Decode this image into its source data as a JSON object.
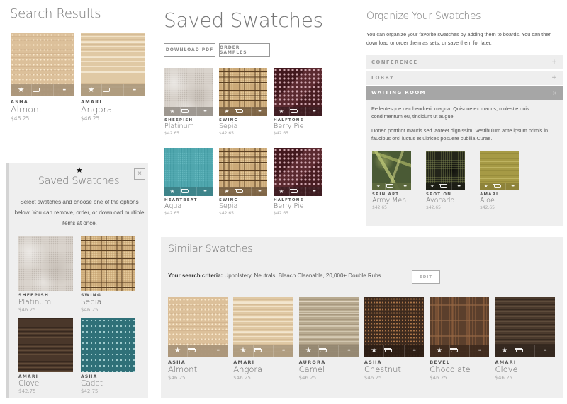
{
  "search_results": {
    "title": "Search Results",
    "items": [
      {
        "brand": "ASHA",
        "name": "Almont",
        "price": "$46.25",
        "texture": "almont",
        "bar_color": "#a99479"
      },
      {
        "brand": "AMARI",
        "name": "Angora",
        "price": "$46.25",
        "texture": "angora",
        "bar_color": "#ad9a7e"
      }
    ]
  },
  "saved_swatches": {
    "title": "Saved Swatches",
    "buttons": {
      "download": "DOWNLOAD PDF",
      "order": "ORDER SAMPLES"
    },
    "items": [
      {
        "brand": "SHEEPISH",
        "name": "Platinum",
        "price": "$42.65",
        "texture": "platinum",
        "bar_color": "#9a948d"
      },
      {
        "brand": "SWING",
        "name": "Sepia",
        "price": "$42.65",
        "texture": "sepia",
        "bar_color": "#7d6446"
      },
      {
        "brand": "HALFTONE",
        "name": "Berry Pie",
        "price": "$42.65",
        "texture": "berry",
        "bar_color": "#3e1d22"
      },
      {
        "brand": "HEARTBEAT",
        "name": "Aqua",
        "price": "$42.65",
        "texture": "aqua",
        "bar_color": "#3c8187"
      },
      {
        "brand": "SWING",
        "name": "Sepia",
        "price": "$42.65",
        "texture": "sepia",
        "bar_color": "#7d6446"
      },
      {
        "brand": "HALFTONE",
        "name": "Berry Pie",
        "price": "$42.65",
        "texture": "berry",
        "bar_color": "#3e1d22"
      }
    ]
  },
  "organize": {
    "title": "Organize Your Swatches",
    "intro": "You can organize your favorite swatches by adding them to boards. You can then download or order them as sets, or save them for later.",
    "boards": [
      {
        "label": "CONFERENCE",
        "icon": "+",
        "expanded": false
      },
      {
        "label": "LOBBY",
        "icon": "+",
        "expanded": false
      },
      {
        "label": "WAITING ROOM",
        "icon": "×",
        "expanded": true
      }
    ],
    "panel": {
      "para1": "Pellentesque nec hendrerit magna. Quisque ex mauris, molestie quis condimentum eu, tincidunt ut augue.",
      "para2": "Donec porttitor mauris sed laoreet dignissim. Vestibulum ante ipsum primis in faucibus orci luctus et ultrices posuere cubilia Curae.",
      "items": [
        {
          "brand": "SPIN ART",
          "name": "Army Men",
          "price": "$42.65",
          "texture": "army",
          "bar_color": "#5d6a3d"
        },
        {
          "brand": "SPOT ON",
          "name": "Avocado",
          "price": "$42.65",
          "texture": "avocado",
          "bar_color": "#1b1c14"
        },
        {
          "brand": "AMARI",
          "name": "Aloe",
          "price": "$42.65",
          "texture": "aloe",
          "bar_color": "#8c8239"
        }
      ]
    }
  },
  "flyout": {
    "star_icon": "★",
    "close_icon": "×",
    "title": "Saved Swatches",
    "description": "Select swatches and choose one of the options below. You can remove, order, or download multiple items at once.",
    "items": [
      {
        "brand": "SHEEPISH",
        "name": "Platinum",
        "price": "$46.25",
        "texture": "platinum"
      },
      {
        "brand": "SWING",
        "name": "Sepia",
        "price": "$46.25",
        "texture": "sepia"
      },
      {
        "brand": "AMARI",
        "name": "Clove",
        "price": "$42.75",
        "texture": "clove"
      },
      {
        "brand": "ASHA",
        "name": "Cadet",
        "price": "$42.75",
        "texture": "cadet"
      }
    ]
  },
  "similar": {
    "title": "Similar Swatches",
    "criteria_label": "Your search criteria:",
    "criteria_value": "Upholstery, Neutrals, Bleach Cleanable, 20,000+ Double Rubs",
    "edit_label": "EDIT",
    "items": [
      {
        "brand": "ASHA",
        "name": "Almont",
        "price": "$46.25",
        "texture": "almont",
        "bar_color": "#a99479"
      },
      {
        "brand": "AMARI",
        "name": "Angora",
        "price": "$46.25",
        "texture": "angora",
        "bar_color": "#ad9a7e"
      },
      {
        "brand": "AURORA",
        "name": "Camel",
        "price": "$46.25",
        "texture": "camel",
        "bar_color": "#938670"
      },
      {
        "brand": "ASHA",
        "name": "Chestnut",
        "price": "$46.25",
        "texture": "chestnut",
        "bar_color": "#2c1e15"
      },
      {
        "brand": "BEVEL",
        "name": "Chocolate",
        "price": "$46.25",
        "texture": "chocolate",
        "bar_color": "#3e2a1d"
      },
      {
        "brand": "AMARI",
        "name": "Clove",
        "price": "$46.25",
        "texture": "clove2",
        "bar_color": "#33271e"
      }
    ]
  },
  "actions": {
    "favorite": "★",
    "cart": "cart",
    "more": "•••"
  }
}
